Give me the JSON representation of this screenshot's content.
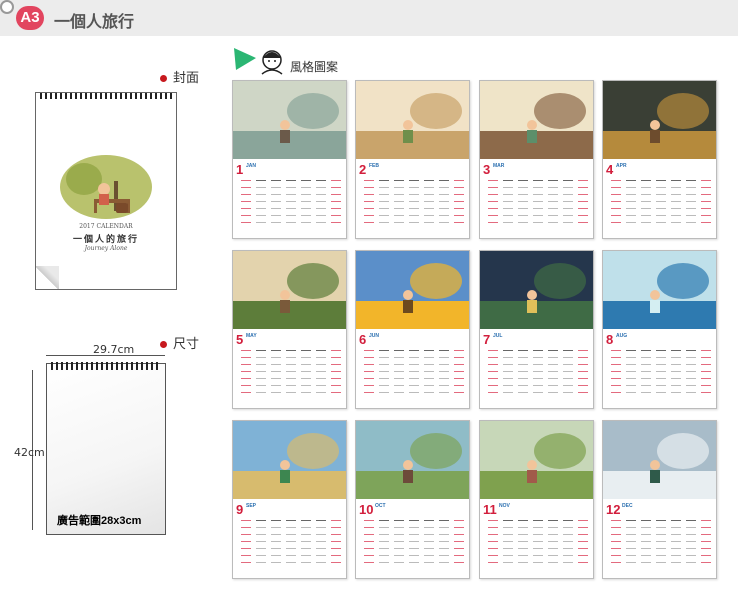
{
  "header": {
    "badge": "A3",
    "title": "一個人旅行"
  },
  "sections": {
    "cover_label": "封面",
    "size_label": "尺寸",
    "style_label": "風格圖案"
  },
  "cover": {
    "calendar_tag": "2017 CALENDAR",
    "title": "一個人的旅行",
    "subtitle": "Journey Alone"
  },
  "size": {
    "width": "29.7cm",
    "height": "42cm",
    "ad_area": "廣告範圍28x3cm"
  },
  "months": [
    {
      "num": "1",
      "name": "JAN",
      "palette": [
        "#cfd6c6",
        "#8aa59a",
        "#6b5a4a"
      ]
    },
    {
      "num": "2",
      "name": "FEB",
      "palette": [
        "#f1e2c6",
        "#c9a46b",
        "#6f8f4b"
      ]
    },
    {
      "num": "3",
      "name": "MAR",
      "palette": [
        "#efe4c8",
        "#8d6a4a",
        "#5c8f6a"
      ]
    },
    {
      "num": "4",
      "name": "APR",
      "palette": [
        "#3a3f35",
        "#b58a3c",
        "#6d4c2d"
      ]
    },
    {
      "num": "5",
      "name": "MAY",
      "palette": [
        "#e3d3ad",
        "#5d7d3a",
        "#7a5a3a"
      ]
    },
    {
      "num": "6",
      "name": "JUN",
      "palette": [
        "#5b8fc9",
        "#f2b52a",
        "#6d4a1e"
      ]
    },
    {
      "num": "7",
      "name": "JUL",
      "palette": [
        "#25364c",
        "#3f6b45",
        "#e0c05a"
      ]
    },
    {
      "num": "8",
      "name": "AUG",
      "palette": [
        "#bfe0ea",
        "#2e7ab0",
        "#d4eef2"
      ]
    },
    {
      "num": "9",
      "name": "SEP",
      "palette": [
        "#7fb2d6",
        "#d7bb6e",
        "#3d8650"
      ]
    },
    {
      "num": "10",
      "name": "OCT",
      "palette": [
        "#8fbcc7",
        "#7ea45a",
        "#6d4a3a"
      ]
    },
    {
      "num": "11",
      "name": "NOV",
      "palette": [
        "#c7d7b8",
        "#7fa14e",
        "#a15a4a"
      ]
    },
    {
      "num": "12",
      "name": "DEC",
      "palette": [
        "#a8bcc9",
        "#e8eef1",
        "#2f5a4a"
      ]
    }
  ]
}
